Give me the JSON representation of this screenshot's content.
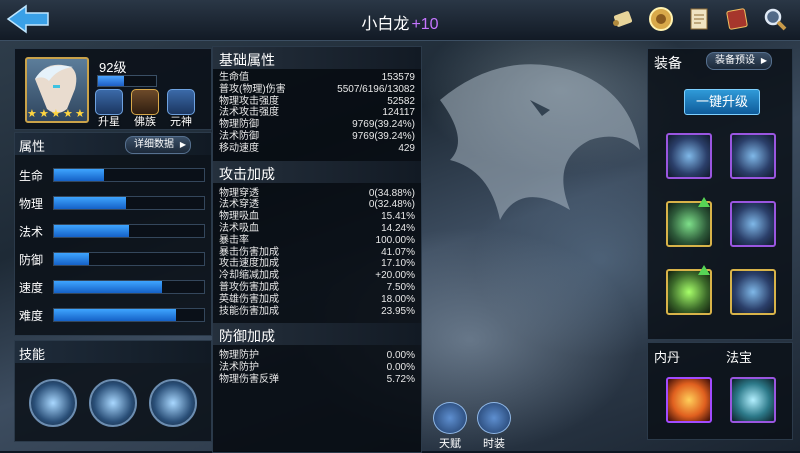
{
  "header": {
    "title": "小白龙",
    "title_plus": "+10"
  },
  "hero": {
    "level": "92级",
    "level_progress": 0.45,
    "stars": 5,
    "buttons": [
      {
        "label": "升星",
        "icon": "star-badge-icon"
      },
      {
        "label": "佛族",
        "icon": "swastika-emblem-icon"
      },
      {
        "label": "元神",
        "icon": "spirit-flame-icon"
      }
    ]
  },
  "attributes": {
    "title": "属性",
    "detail_button": "详细数据",
    "rows": [
      {
        "label": "生命",
        "fill": 0.33
      },
      {
        "label": "物理",
        "fill": 0.48
      },
      {
        "label": "法术",
        "fill": 0.5
      },
      {
        "label": "防御",
        "fill": 0.23
      },
      {
        "label": "速度",
        "fill": 0.72
      },
      {
        "label": "难度",
        "fill": 0.81
      }
    ]
  },
  "skills": {
    "title": "技能",
    "items": [
      "claw-skill-icon",
      "winged-skill-icon",
      "demon-mask-skill-icon"
    ]
  },
  "stats": {
    "basic": {
      "title": "基础属性",
      "rows": [
        {
          "k": "生命值",
          "v": "153579"
        },
        {
          "k": "普攻(物理)伤害",
          "v": "5507/6196/13082"
        },
        {
          "k": "物理攻击强度",
          "v": "52582"
        },
        {
          "k": "法术攻击强度",
          "v": "124117"
        },
        {
          "k": "物理防御",
          "v": "9769(39.24%)"
        },
        {
          "k": "法术防御",
          "v": "9769(39.24%)"
        },
        {
          "k": "移动速度",
          "v": "429"
        }
      ]
    },
    "attack": {
      "title": "攻击加成",
      "rows": [
        {
          "k": "物理穿透",
          "v": "0(34.88%)"
        },
        {
          "k": "法术穿透",
          "v": "0(32.48%)"
        },
        {
          "k": "物理吸血",
          "v": "15.41%"
        },
        {
          "k": "法术吸血",
          "v": "14.24%"
        },
        {
          "k": "暴击率",
          "v": "100.00%"
        },
        {
          "k": "暴击伤害加成",
          "v": "41.07%"
        },
        {
          "k": "攻击速度加成",
          "v": "17.10%"
        },
        {
          "k": "冷却缩减加成",
          "v": "+20.00%"
        },
        {
          "k": "普攻伤害加成",
          "v": "7.50%"
        },
        {
          "k": "英雄伤害加成",
          "v": "18.00%"
        },
        {
          "k": "技能伤害加成",
          "v": "23.95%"
        }
      ]
    },
    "defense": {
      "title": "防御加成",
      "rows": [
        {
          "k": "物理防护",
          "v": "0.00%"
        },
        {
          "k": "法术防护",
          "v": "0.00%"
        },
        {
          "k": "物理伤害反弹",
          "v": "5.72%"
        }
      ]
    }
  },
  "bottom_buttons": [
    {
      "label": "天赋",
      "icon": "talent-icon"
    },
    {
      "label": "时装",
      "icon": "costume-icon"
    }
  ],
  "equipment": {
    "title": "装备",
    "preset_button": "装备预设",
    "upgrade_button": "一键升级"
  },
  "inner": {
    "neidan_label": "内丹",
    "fabao_label": "法宝"
  },
  "top_icons": [
    "scroll-icon",
    "coin-medal-icon",
    "document-icon",
    "book-icon",
    "magnifier-icon"
  ]
}
